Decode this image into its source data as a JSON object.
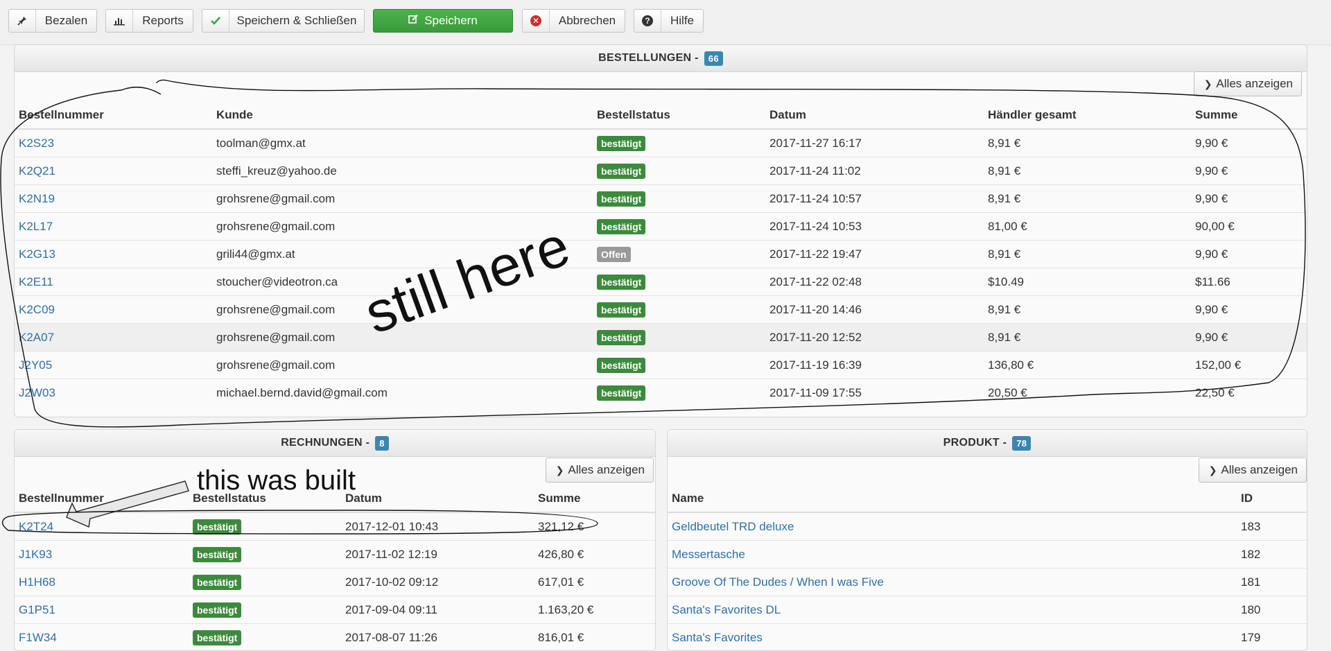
{
  "toolbar": {
    "buttons": [
      {
        "label": "Bezalen",
        "icon": "pin-icon"
      },
      {
        "label": "Reports",
        "icon": "bar-chart-icon"
      },
      {
        "label": "Speichern & Schließen",
        "icon": "check-icon"
      },
      {
        "label": "Speichern",
        "icon": "edit-icon"
      },
      {
        "label": "Abbrechen",
        "icon": "cancel-icon"
      },
      {
        "label": "Hilfe",
        "icon": "help-icon"
      }
    ]
  },
  "orders": {
    "title": "BESTELLUNGEN -",
    "count": "66",
    "show_all": "Alles anzeigen",
    "columns": [
      "Bestellnummer",
      "Kunde",
      "Bestellstatus",
      "Datum",
      "Händler gesamt",
      "Summe"
    ],
    "rows": [
      [
        "K2S23",
        "toolman@gmx.at",
        "bestätigt",
        "2017-11-27 16:17",
        "8,91 €",
        "9,90 €"
      ],
      [
        "K2Q21",
        "steffi_kreuz@yahoo.de",
        "bestätigt",
        "2017-11-24 11:02",
        "8,91 €",
        "9,90 €"
      ],
      [
        "K2N19",
        "grohsrene@gmail.com",
        "bestätigt",
        "2017-11-24 10:57",
        "8,91 €",
        "9,90 €"
      ],
      [
        "K2L17",
        "grohsrene@gmail.com",
        "bestätigt",
        "2017-11-24 10:53",
        "81,00 €",
        "90,00 €"
      ],
      [
        "K2G13",
        "grili44@gmx.at",
        "Offen",
        "2017-11-22 19:47",
        "8,91 €",
        "9,90 €"
      ],
      [
        "K2E11",
        "stoucher@videotron.ca",
        "bestätigt",
        "2017-11-22 02:48",
        "$10.49",
        "$11.66"
      ],
      [
        "K2C09",
        "grohsrene@gmail.com",
        "bestätigt",
        "2017-11-20 14:46",
        "8,91 €",
        "9,90 €"
      ],
      [
        "K2A07",
        "grohsrene@gmail.com",
        "bestätigt",
        "2017-11-20 12:52",
        "8,91 €",
        "9,90 €"
      ],
      [
        "J2Y05",
        "grohsrene@gmail.com",
        "bestätigt",
        "2017-11-19 16:39",
        "136,80 €",
        "152,00 €"
      ],
      [
        "J2W03",
        "michael.bernd.david@gmail.com",
        "bestätigt",
        "2017-11-09 17:55",
        "20,50 €",
        "22,50 €"
      ]
    ]
  },
  "invoices": {
    "title": "RECHNUNGEN -",
    "count": "8",
    "show_all": "Alles anzeigen",
    "columns": [
      "Bestellnummer",
      "Bestellstatus",
      "Datum",
      "Summe"
    ],
    "rows": [
      [
        "K2T24",
        "bestätigt",
        "2017-12-01 10:43",
        "321,12 €"
      ],
      [
        "J1K93",
        "bestätigt",
        "2017-11-02 12:19",
        "426,80 €"
      ],
      [
        "H1H68",
        "bestätigt",
        "2017-10-02 09:12",
        "617,01 €"
      ],
      [
        "G1P51",
        "bestätigt",
        "2017-09-04 09:11",
        "1.163,20 €"
      ],
      [
        "F1W34",
        "bestätigt",
        "2017-08-07 11:26",
        "816,01 €"
      ]
    ]
  },
  "products": {
    "title": "PRODUKT -",
    "count": "78",
    "show_all": "Alles anzeigen",
    "columns": [
      "Name",
      "ID"
    ],
    "rows": [
      [
        "Geldbeutel TRD deluxe",
        "183"
      ],
      [
        "Messertasche",
        "182"
      ],
      [
        "Groove Of The Dudes / When I was Five",
        "181"
      ],
      [
        "Santa's Favorites DL",
        "180"
      ],
      [
        "Santa's Favorites",
        "179"
      ]
    ]
  },
  "annotations": {
    "still_here": "still here",
    "this_was_built": "this was built"
  },
  "colors": {
    "confirmed": "#3c8a3c",
    "open": "#999999",
    "link": "#2f6fa8",
    "count_badge": "#3a87ad",
    "save_green": "#3ea53e"
  }
}
